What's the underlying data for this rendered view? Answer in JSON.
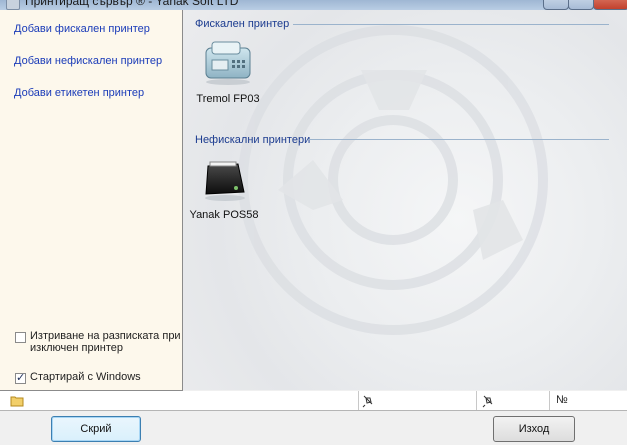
{
  "window": {
    "title": "Принтиращ сървър ® - Yanak Soft LTD"
  },
  "sidebar": {
    "links": [
      {
        "label": "Добави фискален принтер"
      },
      {
        "label": "Добави нефискален принтер"
      },
      {
        "label": "Добави етикетен принтер"
      }
    ],
    "checkboxes": [
      {
        "label_line1": "Изтриване на разписката при",
        "label_line2": "изключен принтер",
        "checked": false
      },
      {
        "label": "Стартирай с Windows",
        "checked": true
      }
    ]
  },
  "printers": {
    "fiscal_group": {
      "header": "Фискален принтер",
      "items": [
        {
          "name": "Tremol FP03",
          "icon": "fiscal-printer-icon"
        }
      ]
    },
    "nonfiscal_group": {
      "header": "Нефискални принтери",
      "items": [
        {
          "name": "Yanak POS58",
          "icon": "receipt-printer-icon"
        }
      ]
    }
  },
  "statusbar": {
    "folder_icon": "folder-icon",
    "pin_icon": "pin-icon",
    "number_label": "№"
  },
  "buttons": {
    "hide": "Скрий",
    "exit": "Изход"
  },
  "colors": {
    "link": "#1a3bb8",
    "group_header": "#1b3b8f",
    "left_pane_bg": "#fdf8ec"
  }
}
